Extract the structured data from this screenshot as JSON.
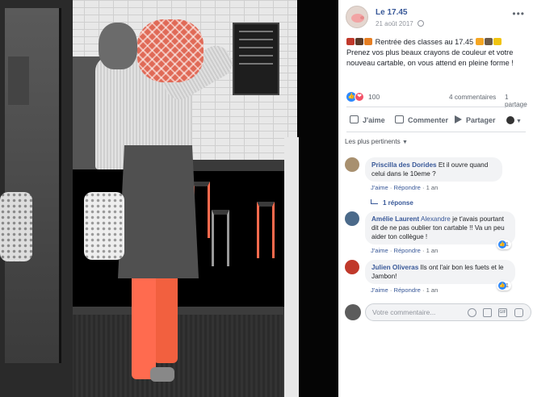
{
  "post": {
    "page_name": "Le 17.45",
    "date": "21 août 2017",
    "more_label": "•••",
    "text": "Rentrée des classes au 17.45 ",
    "text_line2": "Prenez vos plus beaux crayons de couleur et votre nouveau cartable, on vous attend en pleine forme !",
    "emoji_colors": [
      "#c0392b",
      "#5a3b2a",
      "#e67e22",
      "#6b5b4a",
      "#f5a623",
      "#f1c40f"
    ]
  },
  "stats": {
    "reactions_count": "100",
    "comments_count": "4 commentaires",
    "shares_count": "1 partage"
  },
  "actions": {
    "like": "J'aime",
    "comment": "Commenter",
    "share": "Partager"
  },
  "sort_label": "Les plus pertinents",
  "comments": [
    {
      "author": "Priscilla des Dorides",
      "text": "Et il ouvre quand celui dans le 10eme ?",
      "like": "J'aime",
      "reply": "Répondre",
      "time": "1 an",
      "avatar_color": "#a8906f"
    },
    {
      "author": "Amélie Laurent",
      "mention": "Alexandre",
      "text": "je t'avais pourtant dit de ne pas oublier ton cartable !! Va un peu aider ton collègue !",
      "like": "J'aime",
      "reply": "Répondre",
      "time": "1 an",
      "badge": "1",
      "avatar_color": "#4b6a8a"
    },
    {
      "author": "Julien Oliveras",
      "text": "Ils ont l'air bon les fuets et le Jambon!",
      "like": "J'aime",
      "reply": "Répondre",
      "time": "1 an",
      "badge": "1",
      "avatar_color": "#c0392b"
    }
  ],
  "reply_label": "1 réponse",
  "composer": {
    "placeholder": "Votre commentaire..."
  },
  "icons": {
    "more": "more-icon",
    "globe": "globe-icon",
    "like": "like-icon",
    "love": "love-icon",
    "comment": "comment-icon",
    "share": "share-icon",
    "emoji": "emoji-icon",
    "camera": "camera-icon",
    "gif": "gif-icon",
    "sticker": "sticker-icon"
  },
  "colors": {
    "link": "#385898",
    "like_blue": "#2d88ff",
    "love_red": "#f25268",
    "pants_accent": "#ff6b4f"
  }
}
